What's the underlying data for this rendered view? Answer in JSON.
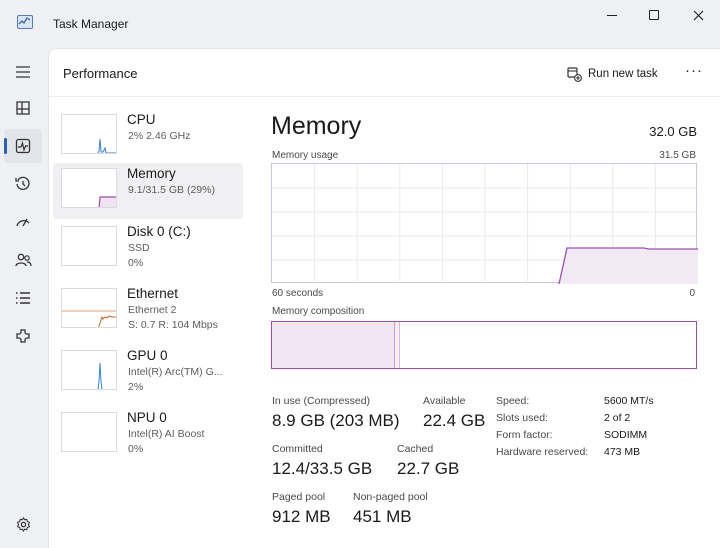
{
  "window": {
    "title": "Task Manager",
    "icon": "task-manager-icon",
    "controls": [
      "minimize-icon",
      "maximize-icon",
      "close-icon"
    ]
  },
  "rail": {
    "items": [
      {
        "name": "hamburger-menu",
        "icon": "menu-icon"
      },
      {
        "name": "processes",
        "icon": "processes-icon"
      },
      {
        "name": "performance",
        "icon": "performance-icon",
        "active": true
      },
      {
        "name": "app-history",
        "icon": "history-icon"
      },
      {
        "name": "startup-apps",
        "icon": "startup-icon"
      },
      {
        "name": "users",
        "icon": "users-icon"
      },
      {
        "name": "details",
        "icon": "details-icon"
      },
      {
        "name": "services",
        "icon": "services-icon"
      },
      {
        "name": "settings",
        "icon": "gear-icon"
      }
    ]
  },
  "header": {
    "title": "Performance",
    "run_new_task": "Run new task",
    "more": "···"
  },
  "resources": [
    {
      "name": "CPU",
      "sub1": "2% 2.46 GHz",
      "sub2": "",
      "color": "#3a7fc6",
      "type": "cpu"
    },
    {
      "name": "Memory",
      "sub1": "9.1/31.5 GB (29%)",
      "sub2": "",
      "color": "#9b4fad",
      "type": "memory",
      "selected": true
    },
    {
      "name": "Disk 0 (C:)",
      "sub1": "SSD",
      "sub2": "0%",
      "color": "#4c9a2a",
      "type": "disk"
    },
    {
      "name": "Ethernet",
      "sub1": "Ethernet 2",
      "sub2": "S: 0.7 R: 104 Mbps",
      "color": "#c26b2c",
      "type": "ethernet"
    },
    {
      "name": "GPU 0",
      "sub1": "Intel(R) Arc(TM) G...",
      "sub2": "2%",
      "color": "#3a7fc6",
      "type": "gpu"
    },
    {
      "name": "NPU 0",
      "sub1": "Intel(R) AI Boost",
      "sub2": "0%",
      "color": "#3a7fc6",
      "type": "npu"
    }
  ],
  "detail": {
    "title": "Memory",
    "total": "32.0 GB",
    "usage_label": "Memory usage",
    "usage_max": "31.5 GB",
    "axis_left": "60 seconds",
    "axis_right": "0",
    "composition_label": "Memory composition",
    "composition": {
      "in_use_fraction": 0.29,
      "modified_fraction": 0.012
    },
    "stats": {
      "in_use_label": "In use (Compressed)",
      "in_use_value": "8.9 GB (203 MB)",
      "available_label": "Available",
      "available_value": "22.4 GB",
      "committed_label": "Committed",
      "committed_value": "12.4/33.5 GB",
      "cached_label": "Cached",
      "cached_value": "22.7 GB",
      "paged_label": "Paged pool",
      "paged_value": "912 MB",
      "nonpaged_label": "Non-paged pool",
      "nonpaged_value": "451 MB"
    },
    "specs": [
      {
        "label": "Speed:",
        "value": "5600 MT/s"
      },
      {
        "label": "Slots used:",
        "value": "2 of 2"
      },
      {
        "label": "Form factor:",
        "value": "SODIMM"
      },
      {
        "label": "Hardware reserved:",
        "value": "473 MB"
      }
    ]
  },
  "colors": {
    "memory": "#9b4fad",
    "memory_fill": "#f1eaf4",
    "grid": "#ece7ef",
    "accent": "#2a5fb0"
  }
}
